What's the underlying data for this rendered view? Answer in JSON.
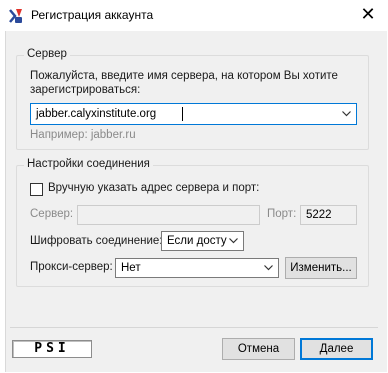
{
  "window": {
    "title": "Регистрация аккаунта",
    "close_glyph": "✕"
  },
  "server_group": {
    "legend": "Сервер",
    "prompt_line1": "Пожалуйста, введите имя сервера, на котором Вы хотите",
    "prompt_line2": "зарегистрироваться:",
    "server_value": "jabber.calyxinstitute.org",
    "example": "Например: jabber.ru"
  },
  "connection_group": {
    "legend": "Настройки соединения",
    "manual_checkbox_label": "Вручную указать адрес сервера и порт:",
    "manual_checked": false,
    "server_label": "Сервер:",
    "server_value": "",
    "port_label": "Порт:",
    "port_value": "5222",
    "encrypt_label": "Шифровать соединение:",
    "encrypt_value": "Если досту",
    "proxy_label": "Прокси-сервер:",
    "proxy_value": "Нет",
    "change_button": "Изменить..."
  },
  "footer": {
    "logo_text": "PSI",
    "cancel_button": "Отмена",
    "next_button": "Далее"
  },
  "colors": {
    "accent": "#0078d7",
    "dialog_bg": "#f0f0f0",
    "title_icon": "#e0332b"
  }
}
